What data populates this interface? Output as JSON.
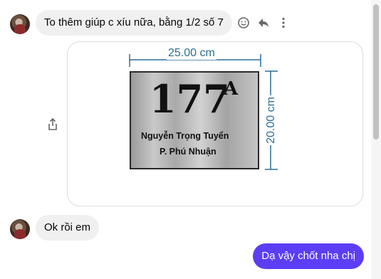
{
  "messages": [
    {
      "sender": "other",
      "text": "To thêm giúp c xíu nữa, bằng 1/2 số 7"
    },
    {
      "sender": "other",
      "text": "Ok rồi em"
    },
    {
      "sender": "me",
      "text": "Dạ vậy chốt nha chị"
    }
  ],
  "attachment": {
    "width_label": "25.00 cm",
    "height_label": "20.00 cm",
    "plate_number": "177",
    "plate_superscript": "A",
    "plate_name": "Nguyễn Trọng Tuyển",
    "plate_district": "P. Phú Nhuận"
  },
  "icons": {
    "react": "emoji-icon",
    "reply": "reply-icon",
    "more": "more-icon",
    "share": "share-icon"
  },
  "colors": {
    "accent": "#5b3ef5",
    "bubble_other": "#f0f0f0",
    "dimension": "#2c6e99"
  }
}
